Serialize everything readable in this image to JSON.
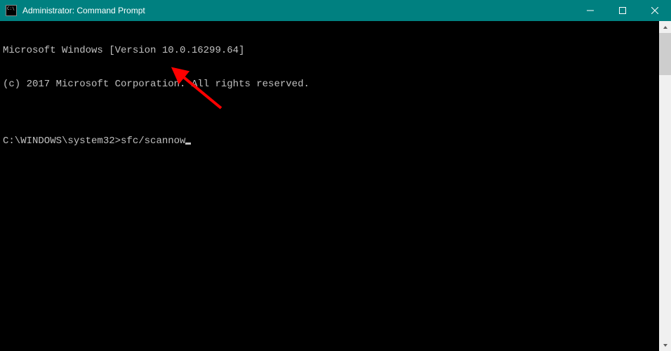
{
  "window": {
    "title": "Administrator: Command Prompt"
  },
  "terminal": {
    "line1": "Microsoft Windows [Version 10.0.16299.64]",
    "line2": "(c) 2017 Microsoft Corporation. All rights reserved.",
    "blank": "",
    "prompt": "C:\\WINDOWS\\system32>",
    "command": "sfc/scannow"
  },
  "colors": {
    "titlebar": "#008080",
    "terminal_bg": "#000000",
    "terminal_fg": "#c0c0c0",
    "arrow": "#ff0000"
  }
}
